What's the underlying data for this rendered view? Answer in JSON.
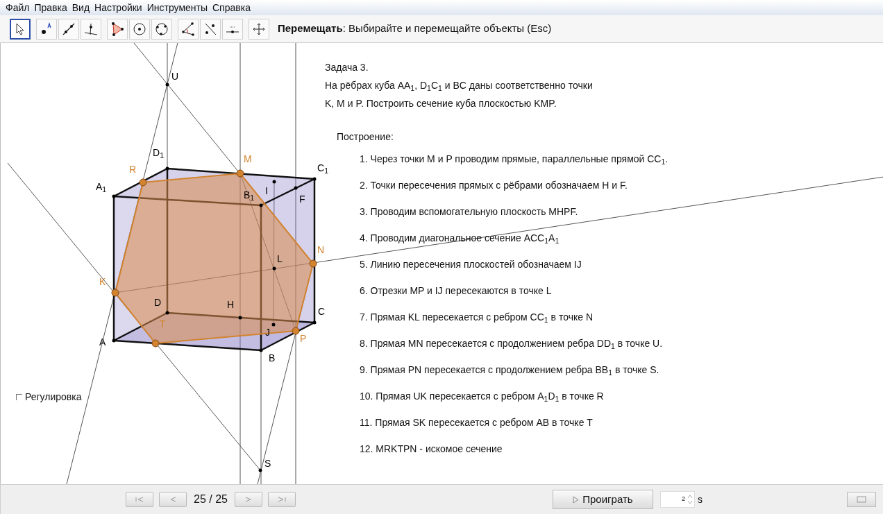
{
  "menu": [
    "Файл",
    "Правка",
    "Вид",
    "Настройки",
    "Инструменты",
    "Справка"
  ],
  "toolbar": {
    "tools": [
      {
        "selected": true
      },
      {
        "selected": false
      },
      {
        "selected": false
      },
      {
        "selected": false
      },
      {
        "selected": false
      },
      {
        "selected": false
      },
      {
        "selected": false
      },
      {
        "selected": false
      },
      {
        "selected": false
      },
      {
        "selected": false
      },
      {
        "selected": false
      }
    ],
    "status": "**Перемещать**: Выбирайте и перемещайте объекты (Esc)"
  },
  "canvas": {
    "points": [
      {
        "label": "U",
        "color": "#000000"
      },
      {
        "label": "D$_{1}$",
        "color": "#000000"
      },
      {
        "label": "A$_{1}$",
        "color": "#000000"
      },
      {
        "label": "R",
        "color": "#d2832f"
      },
      {
        "label": "M",
        "color": "#d2832f"
      },
      {
        "label": "C$_{1}$",
        "color": "#000000"
      },
      {
        "label": "B$_{1}$",
        "color": "#000000"
      },
      {
        "label": "I",
        "color": "#000000"
      },
      {
        "label": "F",
        "color": "#000000"
      },
      {
        "label": "N",
        "color": "#d2832f"
      },
      {
        "label": "L",
        "color": "#000000"
      },
      {
        "label": "K",
        "color": "#d2832f"
      },
      {
        "label": "D",
        "color": "#000000"
      },
      {
        "label": "H",
        "color": "#000000"
      },
      {
        "label": "C",
        "color": "#000000"
      },
      {
        "label": "J",
        "color": "#000000"
      },
      {
        "label": "A",
        "color": "#000000"
      },
      {
        "label": "T",
        "color": "#d2832f"
      },
      {
        "label": "P",
        "color": "#d2832f"
      },
      {
        "label": "B",
        "color": "#000000"
      },
      {
        "label": "S",
        "color": "#000000"
      }
    ],
    "task_title": "Задача 3.",
    "task_lines": [
      "На рёбрах куба AA$_{1}$, D$_{1}$C$_{1}$ и BC даны соответственно точки",
      "K, M и P. Построить сечение куба плоскостью KMP."
    ],
    "construction_heading": "Построение:",
    "steps": [
      "1. Через точки M и P проводим прямые, параллельные прямой CC$_{1}$.",
      "2. Точки пересечения прямых с рёбрами обозначаем H и F.",
      "3. Проводим вспомогательную плоскость MHPF.",
      "4. Проводим диагональное сечение ACC$_{1}$A$_{1}$",
      "5. Линию пересечения плоскостей обозначаем IJ",
      "6. Отрезки MP и IJ пересекаются в точке L",
      "7. Прямая KL пересекается с ребром CC$_{1}$ в точке N",
      "8. Прямая MN пересекается с продолжением ребра DD$_{1}$ в точке U.",
      "9. Прямая PN пересекается с продолжением ребра BB$_{1}$ в точке S.",
      "10. Прямая UK пересекается с ребром A$_{1}$D$_{1}$ в точке R",
      "11. Прямая SK пересекается с ребром AB в точке T",
      "12. MRKTPN - искомое сечение"
    ],
    "checkbox": {
      "label": "Регулировка",
      "checked": false
    }
  },
  "bottom_bar": {
    "step_counter": "25 / 25",
    "play_button": "Проиграть",
    "interval": "2",
    "interval_unit": "s"
  }
}
